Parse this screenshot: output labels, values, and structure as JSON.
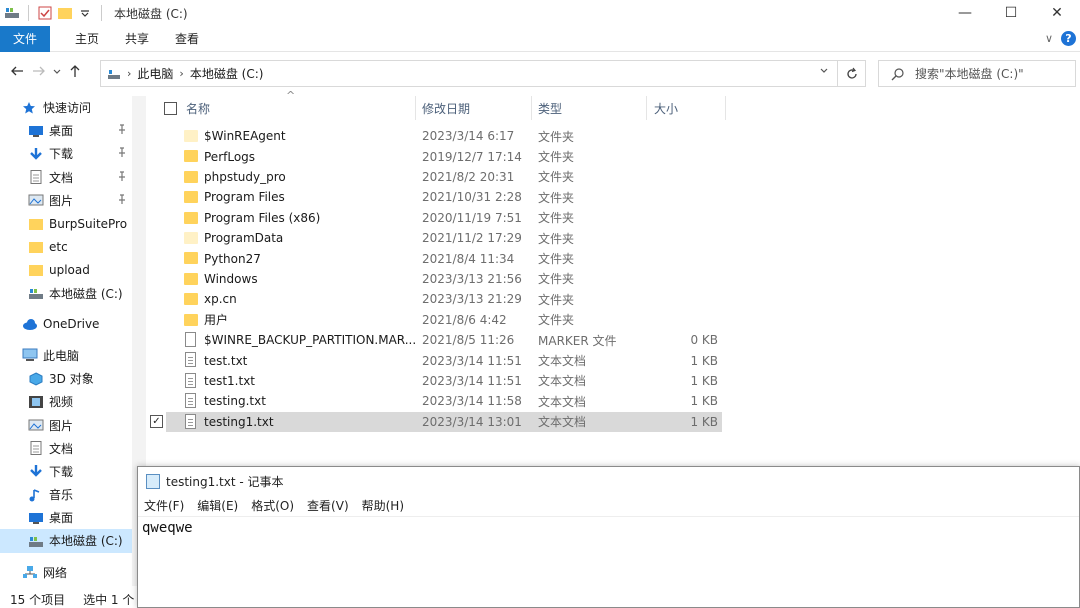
{
  "window": {
    "title": "本地磁盘 (C:)",
    "minimize": "—",
    "maximize": "☐",
    "close": "✕"
  },
  "ribbon": {
    "tabs": [
      "文件",
      "主页",
      "共享",
      "查看"
    ],
    "collapse": "∨",
    "help": "?"
  },
  "address": {
    "crumbs": [
      "此电脑",
      "本地磁盘 (C:)"
    ],
    "search_placeholder": "搜索\"本地磁盘 (C:)\""
  },
  "sidebar": {
    "items": [
      {
        "label": "快速访问",
        "icon": "star-icon",
        "level": 1,
        "pinned": false
      },
      {
        "label": "桌面",
        "icon": "desktop-icon",
        "level": 2,
        "pinned": true
      },
      {
        "label": "下载",
        "icon": "download-icon",
        "level": 2,
        "pinned": true
      },
      {
        "label": "文档",
        "icon": "document-icon",
        "level": 2,
        "pinned": true
      },
      {
        "label": "图片",
        "icon": "picture-icon",
        "level": 2,
        "pinned": true
      },
      {
        "label": "BurpSuitePro",
        "icon": "folder-icon",
        "level": 2,
        "pinned": false
      },
      {
        "label": "etc",
        "icon": "folder-icon",
        "level": 2,
        "pinned": false
      },
      {
        "label": "upload",
        "icon": "folder-icon",
        "level": 2,
        "pinned": false
      },
      {
        "label": "本地磁盘 (C:)",
        "icon": "drive-icon",
        "level": 2,
        "pinned": false
      },
      {
        "label": "OneDrive",
        "icon": "cloud-icon",
        "level": 1,
        "pinned": false,
        "gap_before": true
      },
      {
        "label": "此电脑",
        "icon": "computer-icon",
        "level": 1,
        "pinned": false,
        "gap_before": true
      },
      {
        "label": "3D 对象",
        "icon": "cube-icon",
        "level": 2,
        "pinned": false
      },
      {
        "label": "视频",
        "icon": "video-icon",
        "level": 2,
        "pinned": false
      },
      {
        "label": "图片",
        "icon": "picture-icon",
        "level": 2,
        "pinned": false
      },
      {
        "label": "文档",
        "icon": "document-icon",
        "level": 2,
        "pinned": false
      },
      {
        "label": "下载",
        "icon": "download-icon",
        "level": 2,
        "pinned": false
      },
      {
        "label": "音乐",
        "icon": "music-icon",
        "level": 2,
        "pinned": false
      },
      {
        "label": "桌面",
        "icon": "desktop-icon",
        "level": 2,
        "pinned": false
      },
      {
        "label": "本地磁盘 (C:)",
        "icon": "drive-icon",
        "level": 2,
        "pinned": false,
        "selected": true
      },
      {
        "label": "网络",
        "icon": "network-icon",
        "level": 1,
        "pinned": false,
        "gap_before": true
      }
    ]
  },
  "columns": {
    "name": "名称",
    "date": "修改日期",
    "type": "类型",
    "size": "大小"
  },
  "files": [
    {
      "name": "$WinREAgent",
      "date": "2023/3/14 6:17",
      "type": "文件夹",
      "size": "",
      "kind": "folder-pale"
    },
    {
      "name": "PerfLogs",
      "date": "2019/12/7 17:14",
      "type": "文件夹",
      "size": "",
      "kind": "folder"
    },
    {
      "name": "phpstudy_pro",
      "date": "2021/8/2 20:31",
      "type": "文件夹",
      "size": "",
      "kind": "folder"
    },
    {
      "name": "Program Files",
      "date": "2021/10/31 2:28",
      "type": "文件夹",
      "size": "",
      "kind": "folder"
    },
    {
      "name": "Program Files (x86)",
      "date": "2020/11/19 7:51",
      "type": "文件夹",
      "size": "",
      "kind": "folder"
    },
    {
      "name": "ProgramData",
      "date": "2021/11/2 17:29",
      "type": "文件夹",
      "size": "",
      "kind": "folder-pale"
    },
    {
      "name": "Python27",
      "date": "2021/8/4 11:34",
      "type": "文件夹",
      "size": "",
      "kind": "folder"
    },
    {
      "name": "Windows",
      "date": "2023/3/13 21:56",
      "type": "文件夹",
      "size": "",
      "kind": "folder"
    },
    {
      "name": "xp.cn",
      "date": "2023/3/13 21:29",
      "type": "文件夹",
      "size": "",
      "kind": "folder"
    },
    {
      "name": "用户",
      "date": "2021/8/6 4:42",
      "type": "文件夹",
      "size": "",
      "kind": "folder"
    },
    {
      "name": "$WINRE_BACKUP_PARTITION.MAR...",
      "date": "2021/8/5 11:26",
      "type": "MARKER 文件",
      "size": "0 KB",
      "kind": "doc"
    },
    {
      "name": "test.txt",
      "date": "2023/3/14 11:51",
      "type": "文本文档",
      "size": "1 KB",
      "kind": "txt"
    },
    {
      "name": "test1.txt",
      "date": "2023/3/14 11:51",
      "type": "文本文档",
      "size": "1 KB",
      "kind": "txt"
    },
    {
      "name": "testing.txt",
      "date": "2023/3/14 11:58",
      "type": "文本文档",
      "size": "1 KB",
      "kind": "txt"
    },
    {
      "name": "testing1.txt",
      "date": "2023/3/14 13:01",
      "type": "文本文档",
      "size": "1 KB",
      "kind": "txt",
      "selected": true
    }
  ],
  "status": {
    "count": "15 个项目",
    "selected": "选中 1 个"
  },
  "notepad": {
    "title": "testing1.txt - 记事本",
    "menu": [
      "文件(F)",
      "编辑(E)",
      "格式(O)",
      "查看(V)",
      "帮助(H)"
    ],
    "content": "qweqwe"
  },
  "colors": {
    "accent": "#1979ca",
    "selected_row": "#d9d9d9",
    "selected_nav": "#cce8ff",
    "folder": "#ffd35c"
  }
}
